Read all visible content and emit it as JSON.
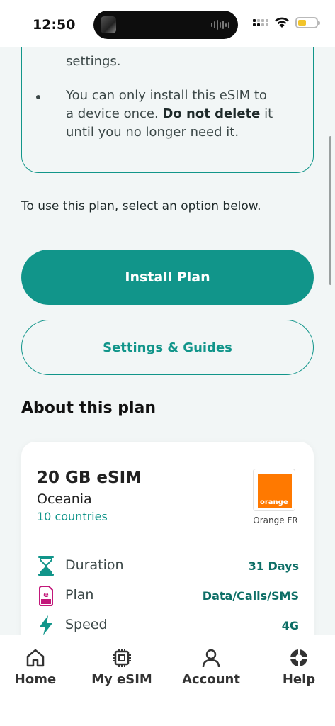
{
  "status_bar": {
    "time": "12:50"
  },
  "notes": {
    "line_partial": "settings.",
    "bullet": {
      "line1": "You can only install this eSIM to",
      "line2_prefix": "a device once. ",
      "line2_bold": "Do not delete",
      "line2_suffix": " it",
      "line3": "until you no longer need it."
    }
  },
  "instruction": "To use this plan, select an option below.",
  "buttons": {
    "install": "Install Plan",
    "settings": "Settings & Guides"
  },
  "about": {
    "title": "About this plan",
    "plan_name": "20 GB eSIM",
    "region": "Oceania",
    "countries": "10 countries",
    "logo_text": "orange",
    "operator": "Orange FR",
    "details": [
      {
        "icon": "hourglass-icon",
        "label": "Duration",
        "value": "31 Days"
      },
      {
        "icon": "esim-card-icon",
        "label": "Plan",
        "value": "Data/Calls/SMS"
      },
      {
        "icon": "lightning-icon",
        "label": "Speed",
        "value": "4G"
      }
    ]
  },
  "tabs": [
    {
      "icon": "home-icon",
      "label": "Home"
    },
    {
      "icon": "chip-icon",
      "label": "My eSIM"
    },
    {
      "icon": "person-icon",
      "label": "Account"
    },
    {
      "icon": "help-icon",
      "label": "Help"
    }
  ],
  "colors": {
    "accent": "#11958a",
    "orange_brand": "#ff7900",
    "battery": "#f2c42b"
  }
}
